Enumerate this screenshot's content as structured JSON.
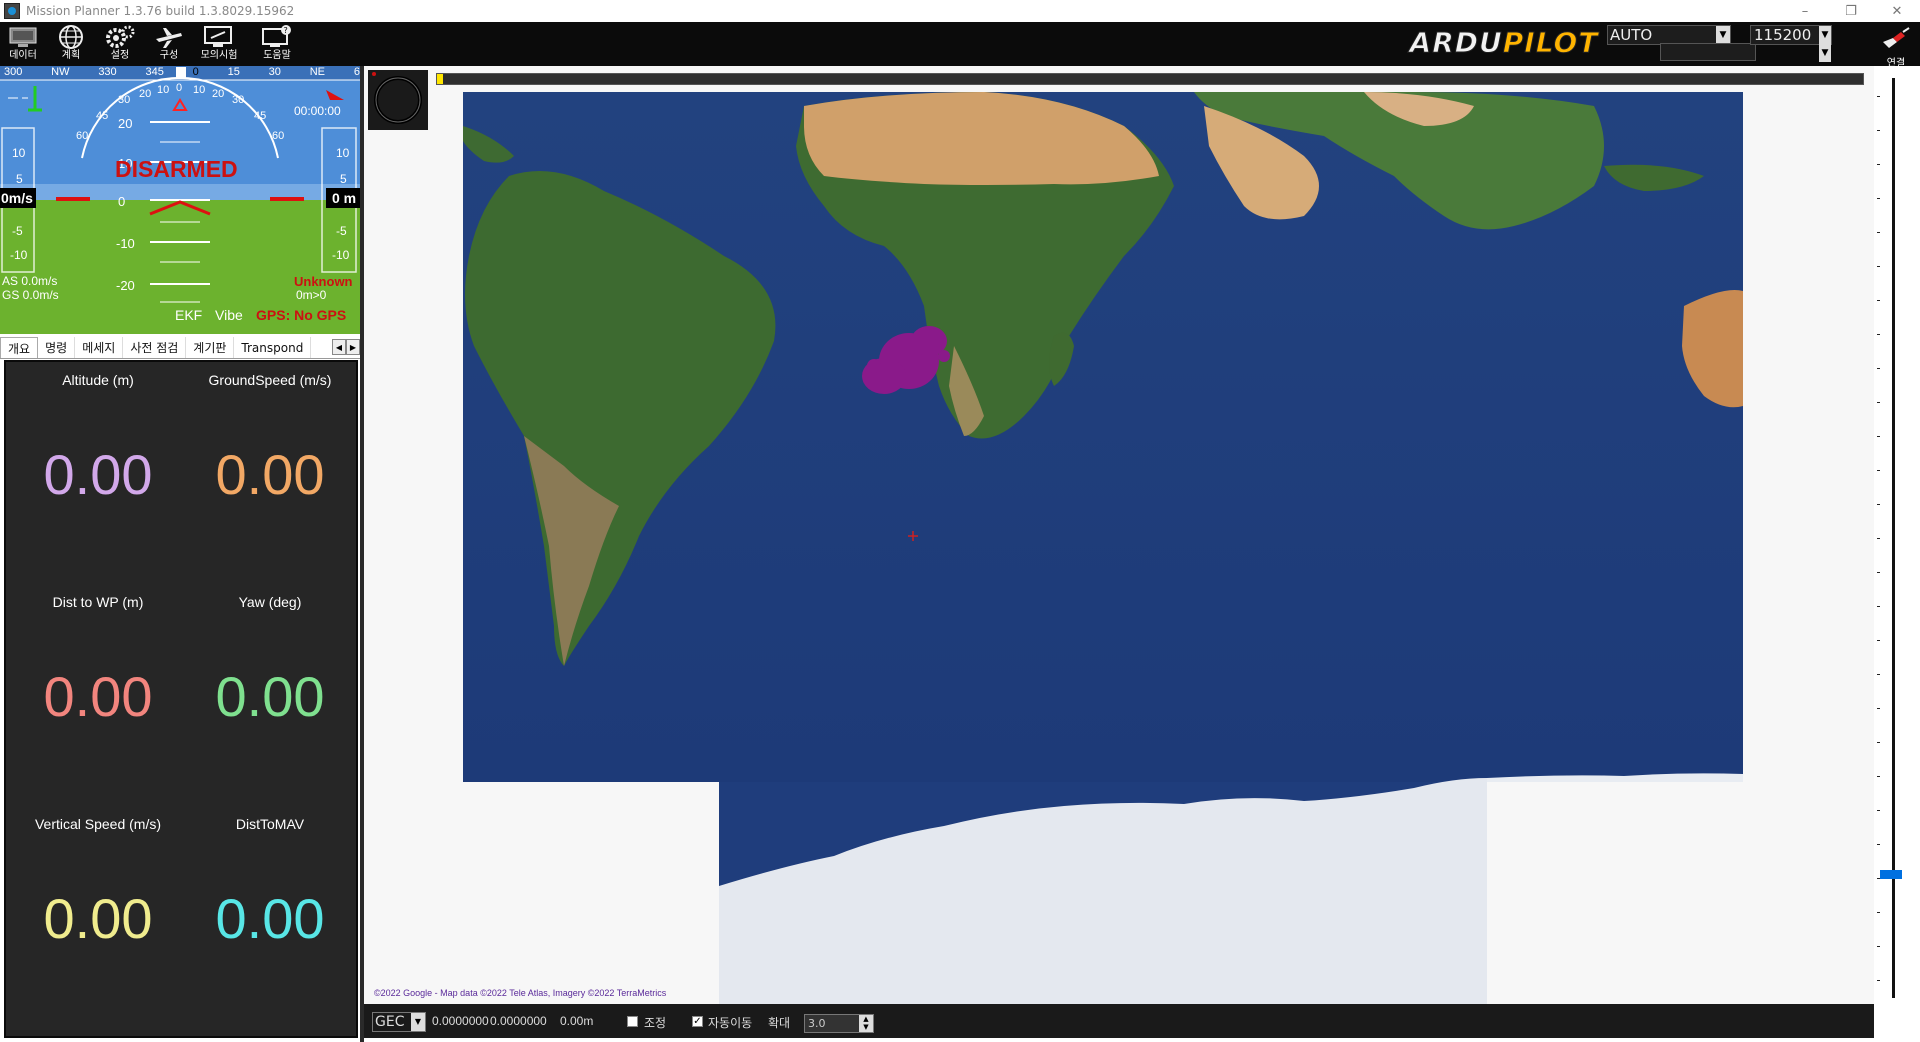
{
  "window": {
    "title": "Mission Planner 1.3.76 build 1.3.8029.15962",
    "controls": [
      "–",
      "❐",
      "✕"
    ]
  },
  "toolbar": {
    "buttons": [
      {
        "label": "데이터",
        "icon": "monitor-icon"
      },
      {
        "label": "계획",
        "icon": "globe-icon"
      },
      {
        "label": "설정",
        "icon": "gears-icon"
      },
      {
        "label": "구성",
        "icon": "plane-wrench-icon"
      },
      {
        "label": "모의시험",
        "icon": "simulation-icon"
      },
      {
        "label": "도움말",
        "icon": "help-icon"
      }
    ],
    "logo_part1": "ARDU",
    "logo_part2": "PILOT",
    "mode": "AUTO",
    "port": "",
    "baud": "115200",
    "connect_label": "연결"
  },
  "hud": {
    "heading_tape": [
      "300",
      "NW",
      "330",
      "345",
      "0",
      "15",
      "30",
      "NE",
      "6"
    ],
    "roll_labels": [
      "60",
      "45",
      "30",
      "20",
      "10",
      "0",
      "10",
      "20",
      "30",
      "45",
      "60"
    ],
    "pitch_labels": [
      "20",
      "10",
      "0",
      "-10",
      "-20"
    ],
    "speed_scale": [
      "10",
      "5",
      "0m/s",
      "-5",
      "-10"
    ],
    "alt_scale": [
      "10",
      "5",
      "0 m",
      "-5",
      "-10"
    ],
    "status": "DISARMED",
    "timer": "00:00:00",
    "airspeed": "AS 0.0m/s",
    "groundspeed": "GS 0.0m/s",
    "mode_text": "Unknown",
    "dist_text": "0m>0",
    "ekf": "EKF",
    "vibe": "Vibe",
    "gps": "GPS: No GPS",
    "colors": {
      "sky": "#4e8ed8",
      "ground": "#6cb22e",
      "alert": "#cc1111"
    }
  },
  "tabs": [
    "개요",
    "명령",
    "메세지",
    "사전 점검",
    "계기판",
    "Transpond"
  ],
  "quick": [
    {
      "label": "Altitude (m)",
      "value": "0.00",
      "color": "#d2a8ea"
    },
    {
      "label": "GroundSpeed (m/s)",
      "value": "0.00",
      "color": "#f2a865"
    },
    {
      "label": "Dist to WP (m)",
      "value": "0.00",
      "color": "#f2857e"
    },
    {
      "label": "Yaw (deg)",
      "value": "0.00",
      "color": "#7fe08f"
    },
    {
      "label": "Vertical Speed (m/s)",
      "value": "0.00",
      "color": "#f0ec8e"
    },
    {
      "label": "DistToMAV",
      "value": "0.00",
      "color": "#58e6e6"
    }
  ],
  "map": {
    "attribution": "©2022 Google - Map data ©2022 Tele Atlas, Imagery ©2022 TerraMetrics",
    "colors": {
      "ocean": "#1f3f82",
      "land_green": "#3f6a30",
      "desert": "#d2a266",
      "ice": "#dfe4ec",
      "marker": "#8a1a8a"
    }
  },
  "statusbar": {
    "coord_system": "GEC",
    "lat": "0.0000000",
    "lng": "0.0000000",
    "alt": "0.00m",
    "adjust_label": "조정",
    "autopan_label": "자동이동",
    "zoom_label": "확대",
    "zoom_value": "3.0"
  }
}
